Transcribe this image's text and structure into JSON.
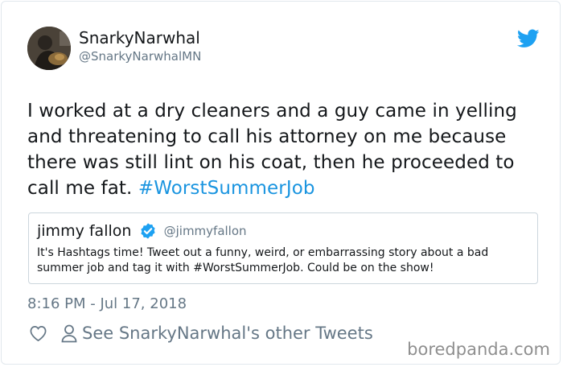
{
  "tweet": {
    "author_name": "SnarkyNarwhal",
    "author_handle": "@SnarkyNarwhalMN",
    "text": "I worked at a dry cleaners and a guy came in yelling and threatening to call his attorney on me because there was still lint on his coat, then he proceeded to call me fat.",
    "hashtag": "#WorstSummerJob",
    "timestamp": "8:16 PM - Jul 17, 2018",
    "other_tweets_link": "See SnarkyNarwhal's other Tweets"
  },
  "quoted_tweet": {
    "author_name": "jimmy fallon",
    "author_handle": "@jimmyfallon",
    "verified": true,
    "text": "It's Hashtags time! Tweet out a funny, weird, or embarrassing story about a bad summer job and tag it with #WorstSummerJob. Could be on the show!"
  },
  "watermark": "boredpanda.com",
  "colors": {
    "hashtag": "#1b95e0",
    "twitter_bird": "#1da1f2",
    "secondary_text": "#657786",
    "border": "#e1e8ed"
  },
  "icons": [
    "twitter-bird-icon",
    "verified-badge-icon",
    "heart-icon",
    "person-icon"
  ]
}
